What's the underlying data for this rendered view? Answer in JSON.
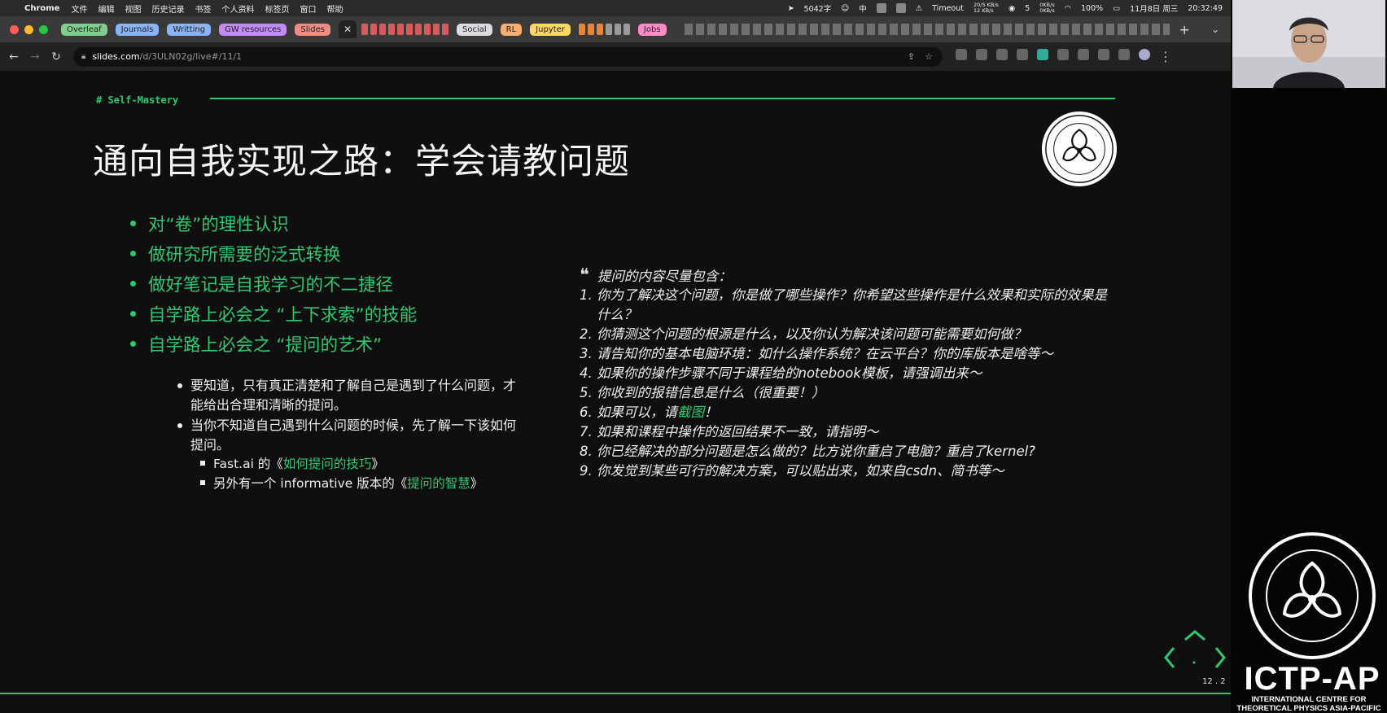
{
  "menubar": {
    "app": "Chrome",
    "items": [
      "文件",
      "编辑",
      "视图",
      "历史记录",
      "书签",
      "个人资料",
      "标签页",
      "窗口",
      "帮助"
    ],
    "status": {
      "word_count": "5042字",
      "input_method": "中",
      "timeout": "Timeout",
      "net_up": "20/S KB/s",
      "net_down": "12 KB/s",
      "wechat_count": "5",
      "disk_up": "0KB/s",
      "disk_down": "0KB/s",
      "battery": "100%",
      "date": "11月8日 周三",
      "time": "20:32:49"
    }
  },
  "tabs": {
    "groups": [
      {
        "label": "Overleaf",
        "color": "#7ecf8e"
      },
      {
        "label": "Journals",
        "color": "#8ab4f8"
      },
      {
        "label": "Writting",
        "color": "#8ab4f8"
      },
      {
        "label": "GW resources",
        "color": "#c58af9"
      },
      {
        "label": "Slides",
        "color": "#f28b82"
      }
    ],
    "groups2": [
      {
        "label": "Social",
        "color": "#dadce0"
      },
      {
        "label": "RL",
        "color": "#fcad70"
      },
      {
        "label": "Jupyter",
        "color": "#fdd663"
      },
      {
        "label": "Jobs",
        "color": "#ff8bcb"
      }
    ],
    "active_close": "✕"
  },
  "address": {
    "host": "slides.com",
    "path": "/d/3ULN02g/live#/11/1"
  },
  "slide": {
    "section": "# Self-Mastery",
    "title": "通向自我实现之路：学会请教问题",
    "topics": [
      "对“卷”的理性认识",
      "做研究所需要的泛式转换",
      "做好笔记是自我学习的不二捷径",
      "自学路上必会之 “上下求索”的技能",
      "自学路上必会之 “提问的艺术”"
    ],
    "sub_points": [
      "要知道，只有真正清楚和了解自己是遇到了什么问题，才能给出合理和清晰的提问。",
      "当你不知道自己遇到什么问题的时候，先了解一下该如何提问。"
    ],
    "sub_sub": [
      {
        "prefix": "Fast.ai 的《",
        "link": "如何提问的技巧",
        "suffix": "》"
      },
      {
        "prefix": "另外有一个 informative 版本的《",
        "link": "提问的智慧",
        "suffix": "》"
      }
    ],
    "quote_head": "提问的内容尽量包含：",
    "quote_items": [
      {
        "num": "1.",
        "text": "你为了解决这个问题，你是做了哪些操作？你希望这些操作是什么效果和实际的效果是什么？"
      },
      {
        "num": "2.",
        "text": "你猜测这个问题的根源是什么，以及你认为解决该问题可能需要如何做？"
      },
      {
        "num": "3.",
        "text": "请告知你的基本电脑环境：如什么操作系统？在云平台？你的库版本是啥等～"
      },
      {
        "num": "4.",
        "text": "如果你的操作步骤不同于课程给的notebook模板，请强调出来～"
      },
      {
        "num": "5.",
        "text": "你收到的报错信息是什么（很重要！）"
      },
      {
        "num": "6.",
        "pre": "如果可以，请",
        "link": "截图",
        "post": "！"
      },
      {
        "num": "7.",
        "text": "如果和课程中操作的返回结果不一致，请指明～"
      },
      {
        "num": "8.",
        "text": "你已经解决的部分问题是怎么做的？比方说你重启了电脑？重启了kernel?"
      },
      {
        "num": "9.",
        "text": "你发觉到某些可行的解决方案，可以贴出来，如来自csdn、简书等～"
      }
    ],
    "slide_number": "12 . 2"
  },
  "branding": {
    "name": "ICTP-AP",
    "sub1": "INTERNATIONAL CENTRE FOR",
    "sub2": "THEORETICAL PHYSICS ASIA-PACIFIC"
  },
  "colors": {
    "accent": "#2ec871",
    "slide_bg": "#0f0f0f"
  }
}
